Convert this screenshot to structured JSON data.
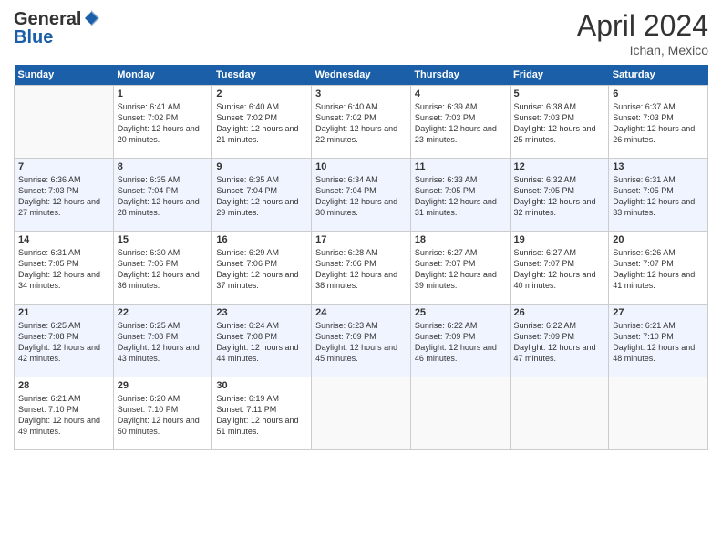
{
  "header": {
    "logo_general": "General",
    "logo_blue": "Blue",
    "title": "April 2024",
    "location": "Ichan, Mexico"
  },
  "days_of_week": [
    "Sunday",
    "Monday",
    "Tuesday",
    "Wednesday",
    "Thursday",
    "Friday",
    "Saturday"
  ],
  "weeks": [
    [
      {
        "day": "",
        "sunrise": "",
        "sunset": "",
        "daylight": ""
      },
      {
        "day": "1",
        "sunrise": "6:41 AM",
        "sunset": "7:02 PM",
        "daylight": "12 hours and 20 minutes."
      },
      {
        "day": "2",
        "sunrise": "6:40 AM",
        "sunset": "7:02 PM",
        "daylight": "12 hours and 21 minutes."
      },
      {
        "day": "3",
        "sunrise": "6:40 AM",
        "sunset": "7:02 PM",
        "daylight": "12 hours and 22 minutes."
      },
      {
        "day": "4",
        "sunrise": "6:39 AM",
        "sunset": "7:03 PM",
        "daylight": "12 hours and 23 minutes."
      },
      {
        "day": "5",
        "sunrise": "6:38 AM",
        "sunset": "7:03 PM",
        "daylight": "12 hours and 25 minutes."
      },
      {
        "day": "6",
        "sunrise": "6:37 AM",
        "sunset": "7:03 PM",
        "daylight": "12 hours and 26 minutes."
      }
    ],
    [
      {
        "day": "7",
        "sunrise": "6:36 AM",
        "sunset": "7:03 PM",
        "daylight": "12 hours and 27 minutes."
      },
      {
        "day": "8",
        "sunrise": "6:35 AM",
        "sunset": "7:04 PM",
        "daylight": "12 hours and 28 minutes."
      },
      {
        "day": "9",
        "sunrise": "6:35 AM",
        "sunset": "7:04 PM",
        "daylight": "12 hours and 29 minutes."
      },
      {
        "day": "10",
        "sunrise": "6:34 AM",
        "sunset": "7:04 PM",
        "daylight": "12 hours and 30 minutes."
      },
      {
        "day": "11",
        "sunrise": "6:33 AM",
        "sunset": "7:05 PM",
        "daylight": "12 hours and 31 minutes."
      },
      {
        "day": "12",
        "sunrise": "6:32 AM",
        "sunset": "7:05 PM",
        "daylight": "12 hours and 32 minutes."
      },
      {
        "day": "13",
        "sunrise": "6:31 AM",
        "sunset": "7:05 PM",
        "daylight": "12 hours and 33 minutes."
      }
    ],
    [
      {
        "day": "14",
        "sunrise": "6:31 AM",
        "sunset": "7:05 PM",
        "daylight": "12 hours and 34 minutes."
      },
      {
        "day": "15",
        "sunrise": "6:30 AM",
        "sunset": "7:06 PM",
        "daylight": "12 hours and 36 minutes."
      },
      {
        "day": "16",
        "sunrise": "6:29 AM",
        "sunset": "7:06 PM",
        "daylight": "12 hours and 37 minutes."
      },
      {
        "day": "17",
        "sunrise": "6:28 AM",
        "sunset": "7:06 PM",
        "daylight": "12 hours and 38 minutes."
      },
      {
        "day": "18",
        "sunrise": "6:27 AM",
        "sunset": "7:07 PM",
        "daylight": "12 hours and 39 minutes."
      },
      {
        "day": "19",
        "sunrise": "6:27 AM",
        "sunset": "7:07 PM",
        "daylight": "12 hours and 40 minutes."
      },
      {
        "day": "20",
        "sunrise": "6:26 AM",
        "sunset": "7:07 PM",
        "daylight": "12 hours and 41 minutes."
      }
    ],
    [
      {
        "day": "21",
        "sunrise": "6:25 AM",
        "sunset": "7:08 PM",
        "daylight": "12 hours and 42 minutes."
      },
      {
        "day": "22",
        "sunrise": "6:25 AM",
        "sunset": "7:08 PM",
        "daylight": "12 hours and 43 minutes."
      },
      {
        "day": "23",
        "sunrise": "6:24 AM",
        "sunset": "7:08 PM",
        "daylight": "12 hours and 44 minutes."
      },
      {
        "day": "24",
        "sunrise": "6:23 AM",
        "sunset": "7:09 PM",
        "daylight": "12 hours and 45 minutes."
      },
      {
        "day": "25",
        "sunrise": "6:22 AM",
        "sunset": "7:09 PM",
        "daylight": "12 hours and 46 minutes."
      },
      {
        "day": "26",
        "sunrise": "6:22 AM",
        "sunset": "7:09 PM",
        "daylight": "12 hours and 47 minutes."
      },
      {
        "day": "27",
        "sunrise": "6:21 AM",
        "sunset": "7:10 PM",
        "daylight": "12 hours and 48 minutes."
      }
    ],
    [
      {
        "day": "28",
        "sunrise": "6:21 AM",
        "sunset": "7:10 PM",
        "daylight": "12 hours and 49 minutes."
      },
      {
        "day": "29",
        "sunrise": "6:20 AM",
        "sunset": "7:10 PM",
        "daylight": "12 hours and 50 minutes."
      },
      {
        "day": "30",
        "sunrise": "6:19 AM",
        "sunset": "7:11 PM",
        "daylight": "12 hours and 51 minutes."
      },
      {
        "day": "",
        "sunrise": "",
        "sunset": "",
        "daylight": ""
      },
      {
        "day": "",
        "sunrise": "",
        "sunset": "",
        "daylight": ""
      },
      {
        "day": "",
        "sunrise": "",
        "sunset": "",
        "daylight": ""
      },
      {
        "day": "",
        "sunrise": "",
        "sunset": "",
        "daylight": ""
      }
    ]
  ],
  "labels": {
    "sunrise_prefix": "Sunrise: ",
    "sunset_prefix": "Sunset: ",
    "daylight_prefix": "Daylight: "
  }
}
